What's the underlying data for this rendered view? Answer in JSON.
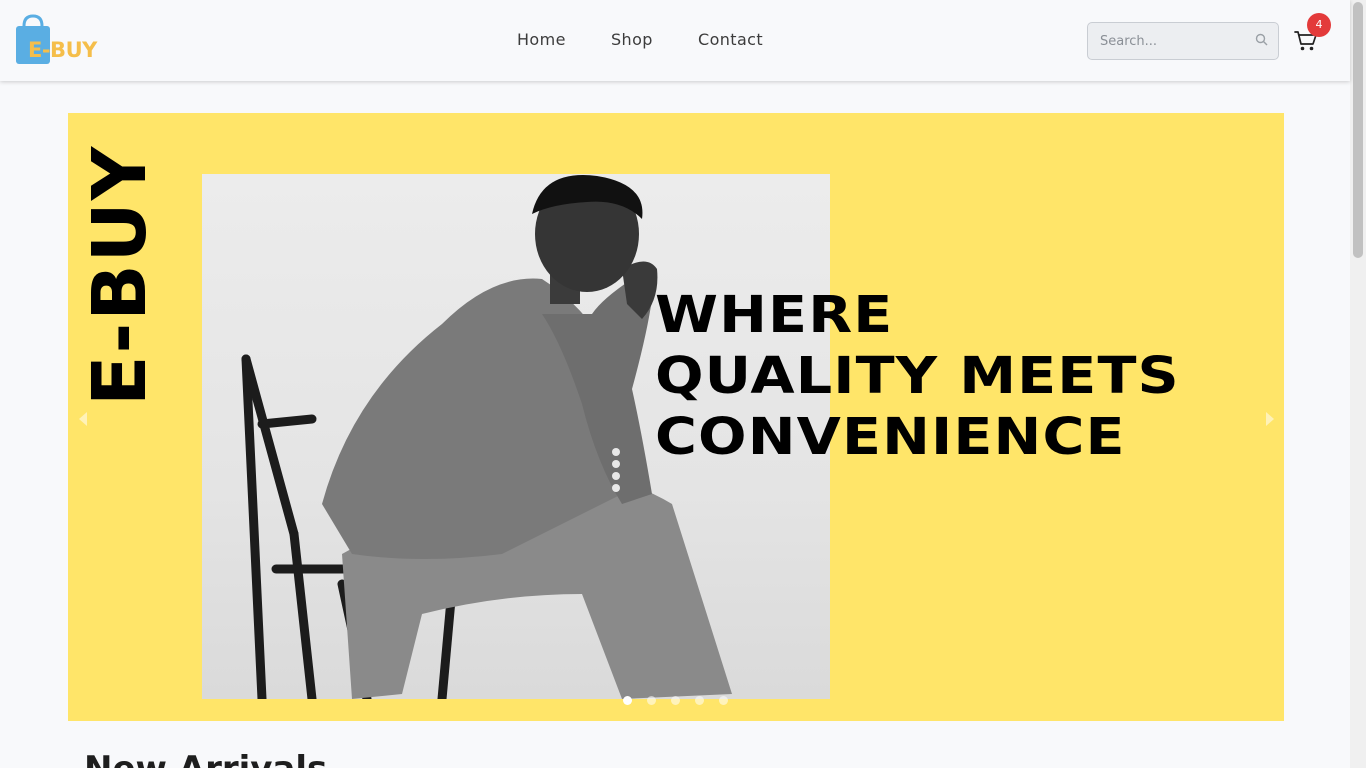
{
  "header": {
    "logo_text": "E-BUY",
    "nav": [
      {
        "label": "Home"
      },
      {
        "label": "Shop"
      },
      {
        "label": "Contact"
      }
    ],
    "search": {
      "placeholder": "Search...",
      "value": ""
    },
    "cart_count": "4",
    "icons": {
      "search": "magnifier-icon",
      "cart": "cart-icon"
    }
  },
  "hero": {
    "vertical_brand": "E-BUY",
    "headline_lines": [
      "WHERE",
      "QUALITY MEETS",
      "CONVENIENCE"
    ],
    "slide_count": 5,
    "active_slide": 1,
    "background_color": "#ffe569"
  },
  "sections": {
    "new_arrivals_title": "New Arrivals"
  },
  "colors": {
    "accent_yellow": "#ffe569",
    "logo_blue": "#5aaee3",
    "logo_orange": "#f5be4a",
    "badge_red": "#e33a3a"
  }
}
